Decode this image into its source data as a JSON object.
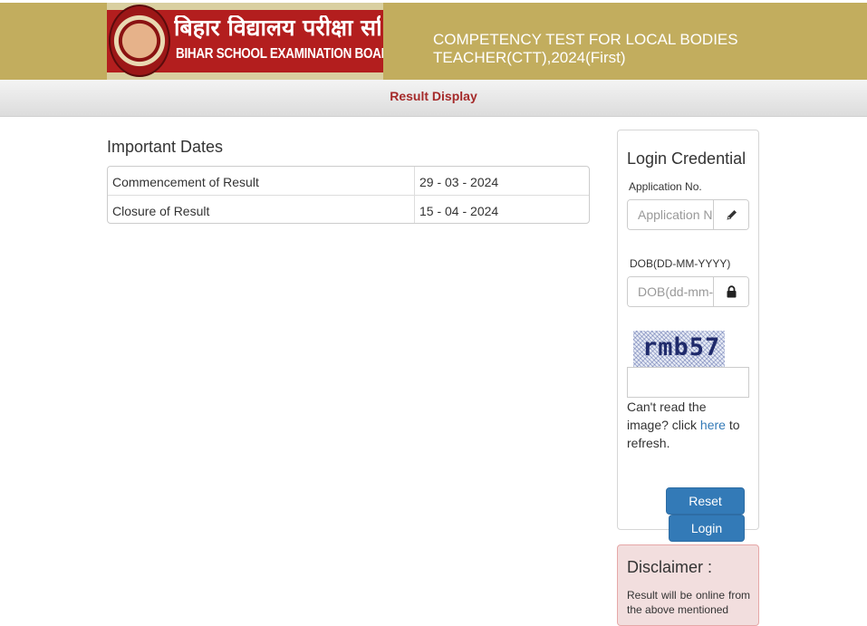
{
  "header": {
    "logo_hindi": "बिहार विद्यालय परीक्षा समिति",
    "logo_english": "BIHAR SCHOOL EXAMINATION BOARD",
    "exam_title": "COMPETENCY TEST FOR LOCAL BODIES TEACHER(CTT),2024(First)"
  },
  "nav": {
    "title": "Result Display"
  },
  "important_dates": {
    "title": "Important Dates",
    "rows": [
      {
        "label": "Commencement of Result",
        "value": "29 - 03 - 2024"
      },
      {
        "label": "Closure of Result",
        "value": "15 - 04 - 2024"
      }
    ]
  },
  "login": {
    "title": "Login Credential",
    "application_label": "Application No.",
    "application_placeholder": "Application No.",
    "application_value": "",
    "dob_label": "DOB(DD-MM-YYYY)",
    "dob_placeholder": "DOB(dd-mm-yyyy)",
    "dob_value": "",
    "captcha_text": "rmb57",
    "captcha_value": "",
    "refresh_prefix": "Can't read the image? click ",
    "refresh_link": "here",
    "refresh_suffix": " to refresh.",
    "reset_label": "Reset",
    "login_label": "Login",
    "icons": {
      "application": "pencil-icon",
      "dob": "lock-icon"
    }
  },
  "disclaimer": {
    "title": "Disclaimer :",
    "text": "Result will be online from the above mentioned"
  },
  "colors": {
    "header_bg": "#c2ad5e",
    "nav_title": "#a52a2a",
    "button": "#337ab7",
    "link": "#337ab7",
    "disclaimer_bg": "#f2dede"
  }
}
